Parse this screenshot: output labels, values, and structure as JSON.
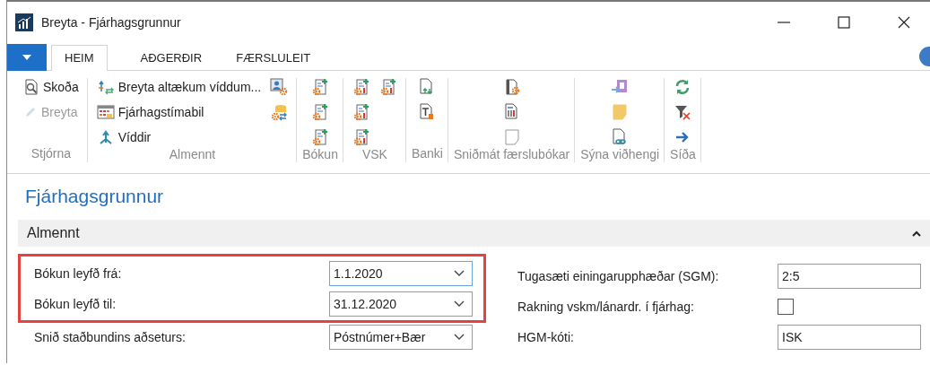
{
  "window": {
    "title": "Breyta - Fjárhagsgrunnur"
  },
  "tabs": [
    {
      "label": "HEIM",
      "selected": true
    },
    {
      "label": "AÐGERÐIR",
      "selected": false
    },
    {
      "label": "FÆRSLULEIT",
      "selected": false
    }
  ],
  "ribbon": [
    {
      "label": "Stjórna",
      "columns": [
        [
          {
            "label": "Skoða",
            "disabled": false
          },
          {
            "label": "Breyta",
            "disabled": true
          }
        ]
      ]
    },
    {
      "label": "Almennt",
      "columns": [
        [
          {
            "label": "Breyta altækum víddum...",
            "disabled": false
          },
          {
            "label": "Fjárhagstímabil",
            "disabled": false
          },
          {
            "label": "Víddir",
            "disabled": false
          }
        ],
        [
          {
            "disabled": false
          },
          {
            "disabled": false
          }
        ]
      ]
    },
    {
      "label": "Bókun",
      "columns": [
        [
          {
            "disabled": false
          },
          {
            "disabled": false
          },
          {
            "disabled": false
          }
        ]
      ]
    },
    {
      "label": "VSK",
      "columns": [
        [
          {
            "disabled": false
          },
          {
            "disabled": false
          },
          {
            "disabled": false
          }
        ],
        [
          {
            "disabled": false
          }
        ]
      ]
    },
    {
      "label": "Banki",
      "columns": [
        [
          {
            "disabled": false
          },
          {
            "disabled": false
          }
        ]
      ]
    },
    {
      "label": "Sniðmát færslubókar",
      "columns": [
        [
          {
            "disabled": false
          },
          {
            "disabled": false
          },
          {
            "disabled": true
          }
        ]
      ]
    },
    {
      "label": "Sýna viðhengi",
      "columns": [
        [
          {
            "disabled": false
          },
          {
            "disabled": false
          },
          {
            "disabled": false
          }
        ]
      ]
    },
    {
      "label": "Síða",
      "columns": [
        [
          {
            "disabled": false
          },
          {
            "disabled": false
          },
          {
            "disabled": false
          }
        ]
      ]
    }
  ],
  "page": {
    "title": "Fjárhagsgrunnur",
    "section": {
      "title": "Almennt",
      "expanded": true,
      "left_groups": [
        {
          "highlighted": true,
          "fields": [
            {
              "label": "Bókun leyfð frá:",
              "kind": "dropdown",
              "value": "1.1.2020",
              "focused": true
            },
            {
              "label": "Bókun leyfð til:",
              "kind": "dropdown",
              "value": "31.12.2020",
              "focused": false
            }
          ]
        },
        {
          "highlighted": false,
          "fields": [
            {
              "label": "Snið staðbundins aðseturs:",
              "kind": "dropdown",
              "value": "Póstnúmer+Bær",
              "focused": false
            }
          ]
        }
      ],
      "right_fields": [
        {
          "label": "Tugasæti einingarupphæðar (SGM):",
          "kind": "text",
          "value": "2:5",
          "focused": false
        },
        {
          "label": "Rakning vskm/lánardr. í fjárhag:",
          "kind": "checkbox",
          "checked": false
        },
        {
          "label": "HGM-kóti:",
          "kind": "text",
          "value": "ISK",
          "focused": false
        }
      ]
    }
  }
}
